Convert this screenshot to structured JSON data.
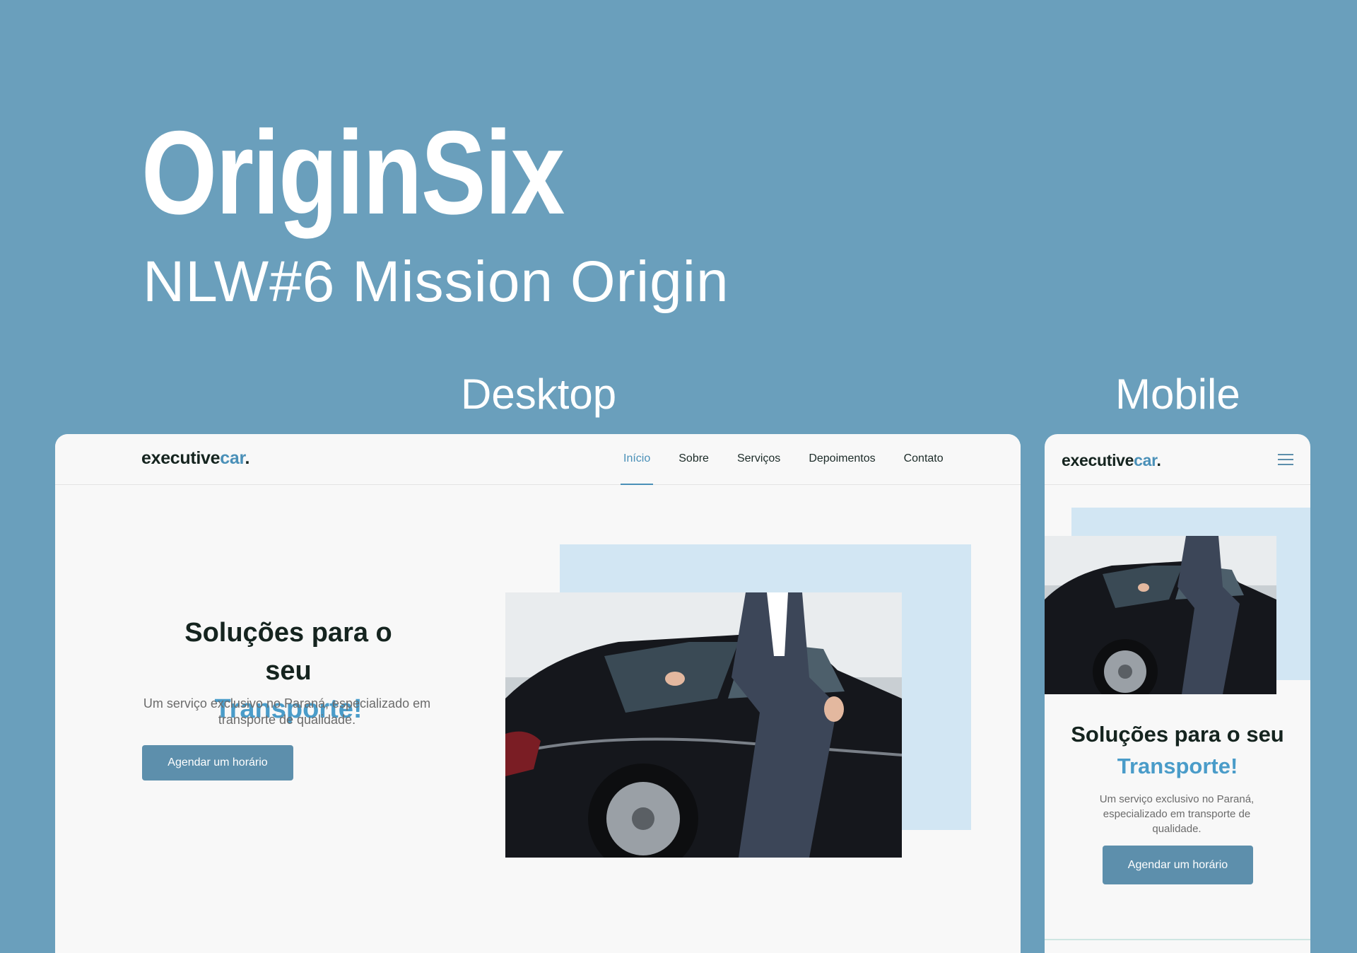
{
  "title": "OriginSix",
  "subtitle": "NLW#6 Mission Origin",
  "labels": {
    "desktop": "Desktop",
    "mobile": "Mobile"
  },
  "site": {
    "logo": {
      "main": "executive",
      "accent": "car",
      "dot": "."
    },
    "nav": [
      "Início",
      "Sobre",
      "Serviços",
      "Depoimentos",
      "Contato"
    ],
    "active_nav": "Início",
    "hero": {
      "title_line1": "Soluções para o seu",
      "title_line2": "Transporte!",
      "text": "Um serviço exclusivo no Paraná, especializado em transporte de qualidade.",
      "button": "Agendar um horário"
    }
  },
  "colors": {
    "background": "#6a9fbc",
    "accent": "#4a9cc9",
    "button": "#5d8fac",
    "panel": "#d2e6f3"
  },
  "icons": {
    "menu": "hamburger-menu-icon"
  }
}
